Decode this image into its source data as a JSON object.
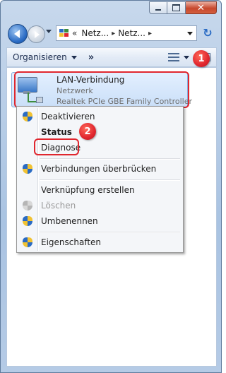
{
  "window": {
    "minimize_icon": "minimize-icon",
    "maximize_icon": "maximize-icon",
    "close_glyph": "✕"
  },
  "nav": {
    "address_parts": [
      "Netz...",
      "Netz..."
    ],
    "address_prefix": "«",
    "separator": "▸",
    "refresh_glyph": "↻"
  },
  "toolbar": {
    "organize_label": "Organisieren",
    "more_label": "»"
  },
  "connection": {
    "name": "LAN-Verbindung",
    "type": "Netzwerk",
    "adapter": "Realtek PCIe GBE Family Controller"
  },
  "context_menu": {
    "items": [
      {
        "label": "Deaktivieren",
        "shield": true
      },
      {
        "label": "Status",
        "bold": true
      },
      {
        "label": "Diagnose"
      },
      {
        "label": "Verbindungen überbrücken",
        "shield": true
      },
      {
        "label": "Verknüpfung erstellen"
      },
      {
        "label": "Löschen",
        "shield": true,
        "disabled": true
      },
      {
        "label": "Umbenennen",
        "shield": true
      },
      {
        "label": "Eigenschaften",
        "shield": true
      }
    ]
  },
  "annotations": {
    "badge_1": "1",
    "badge_2": "2",
    "highlight_color": "#e0262e"
  }
}
